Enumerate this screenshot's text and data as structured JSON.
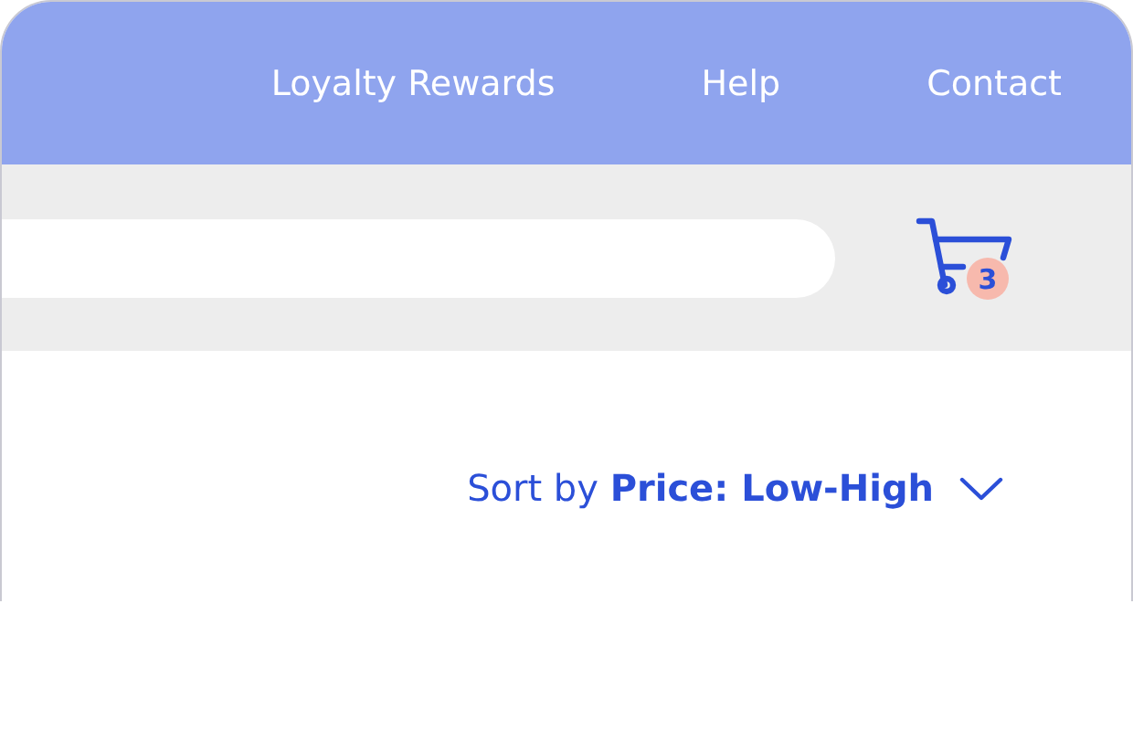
{
  "nav": {
    "links": [
      "Loyalty Rewards",
      "Help",
      "Contact"
    ]
  },
  "cart": {
    "count": "3"
  },
  "sort": {
    "label": "Sort by **Price: Low-High**"
  }
}
